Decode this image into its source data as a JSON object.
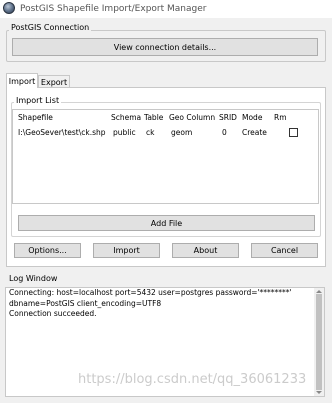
{
  "window": {
    "title": "PostGIS Shapefile Import/Export Manager"
  },
  "connection": {
    "group_label": "PostGIS Connection",
    "view_button": "View connection details..."
  },
  "tabs": [
    {
      "label": "Import",
      "active": true
    },
    {
      "label": "Export",
      "active": false
    }
  ],
  "import_list": {
    "group_label": "Import List",
    "columns": [
      "Shapefile",
      "Schema",
      "Table",
      "Geo Column",
      "SRID",
      "Mode",
      "Rm"
    ],
    "rows": [
      {
        "shapefile": "I:\\GeoSever\\test\\ck.shp",
        "schema": "public",
        "table": "ck",
        "geo_column": "geom",
        "srid": "0",
        "mode": "Create",
        "rm": false
      }
    ],
    "add_file_button": "Add File"
  },
  "actions": {
    "options": "Options...",
    "import": "Import",
    "about": "About",
    "cancel": "Cancel"
  },
  "log": {
    "group_label": "Log Window",
    "text": "Connecting:  host=localhost port=5432 user=postgres password='********'\ndbname=PostGIS client_encoding=UTF8\nConnection succeeded."
  },
  "watermark": "https://blog.csdn.net/qq_36061233",
  "colors": {
    "dialog_bg": "#f0f0f0",
    "button_bg": "#e1e1e1",
    "border": "#c8c8c8"
  }
}
